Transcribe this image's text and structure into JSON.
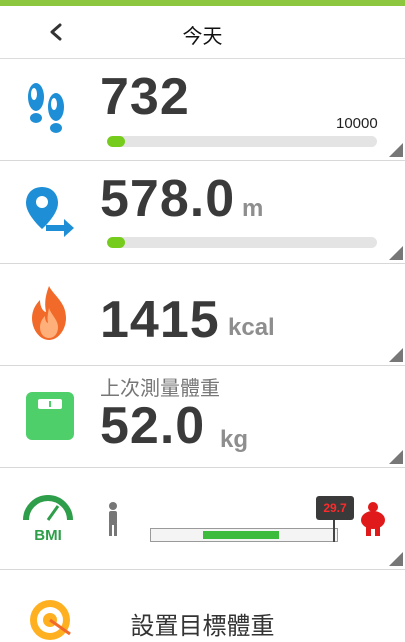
{
  "header": {
    "title": "今天"
  },
  "steps": {
    "value": "732",
    "goal": "10000",
    "progress": 0.0732
  },
  "distance": {
    "value": "578.0",
    "unit": "m",
    "progress": 0.0732
  },
  "calories": {
    "value": "1415",
    "unit": "kcal"
  },
  "weight": {
    "caption": "上次測量體重",
    "value": "52.0",
    "unit": "kg"
  },
  "bmi": {
    "label": "BMI",
    "value": "29.7"
  },
  "target": {
    "label": "設置目標體重"
  },
  "colors": {
    "accent": "#8dc63f",
    "progress": "#76cc1c",
    "icon_blue": "#1e8fd6",
    "icon_green": "#4fcf6a",
    "bmi_flag": "#ff2a2a"
  }
}
